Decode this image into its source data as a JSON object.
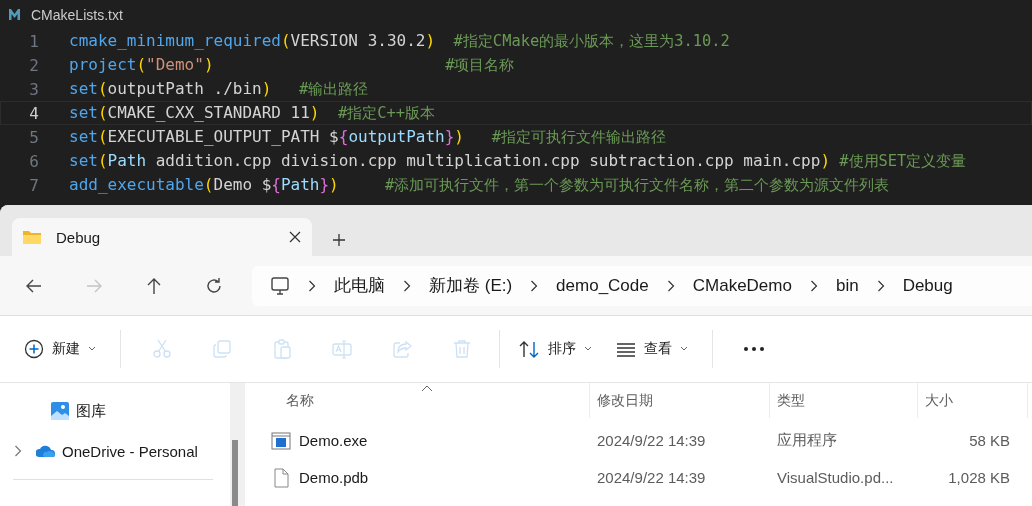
{
  "editor": {
    "file_tab": {
      "title": "CMakeLists.txt"
    },
    "lines": [
      {
        "number": "1",
        "current": false,
        "tokens": [
          {
            "kind": "func",
            "text": "cmake_minimum_required"
          },
          {
            "kind": "paren",
            "text": "("
          },
          {
            "kind": "plain",
            "text": "VERSION 3.30.2"
          },
          {
            "kind": "paren",
            "text": ")"
          },
          {
            "kind": "comment",
            "text": "  #指定CMake的最小版本，这里为3.10.2"
          }
        ]
      },
      {
        "number": "2",
        "current": false,
        "tokens": [
          {
            "kind": "func",
            "text": "project"
          },
          {
            "kind": "paren",
            "text": "("
          },
          {
            "kind": "string",
            "text": "\"Demo\""
          },
          {
            "kind": "paren",
            "text": ")"
          },
          {
            "kind": "comment",
            "text": "                         #项目名称"
          }
        ]
      },
      {
        "number": "3",
        "current": false,
        "tokens": [
          {
            "kind": "func",
            "text": "set"
          },
          {
            "kind": "paren",
            "text": "("
          },
          {
            "kind": "plain",
            "text": "outputPath ./bin"
          },
          {
            "kind": "paren",
            "text": ")"
          },
          {
            "kind": "comment",
            "text": "   #输出路径"
          }
        ]
      },
      {
        "number": "4",
        "current": true,
        "tokens": [
          {
            "kind": "func",
            "text": "set"
          },
          {
            "kind": "paren",
            "text": "("
          },
          {
            "kind": "plain",
            "text": "CMAKE_CXX_STANDARD 11"
          },
          {
            "kind": "paren",
            "text": ")"
          },
          {
            "kind": "comment",
            "text": "  #指定C++版本"
          }
        ]
      },
      {
        "number": "5",
        "current": false,
        "tokens": [
          {
            "kind": "func",
            "text": "set"
          },
          {
            "kind": "paren",
            "text": "("
          },
          {
            "kind": "plain",
            "text": "EXECUTABLE_OUTPUT_PATH $"
          },
          {
            "kind": "brace",
            "text": "{"
          },
          {
            "kind": "var",
            "text": "outputPath"
          },
          {
            "kind": "brace",
            "text": "}"
          },
          {
            "kind": "paren",
            "text": ")"
          },
          {
            "kind": "comment",
            "text": "   #指定可执行文件输出路径"
          }
        ]
      },
      {
        "number": "6",
        "current": false,
        "tokens": [
          {
            "kind": "func",
            "text": "set"
          },
          {
            "kind": "paren",
            "text": "("
          },
          {
            "kind": "var",
            "text": "Path"
          },
          {
            "kind": "plain",
            "text": " addition.cpp division.cpp multiplication.cpp subtraction.cpp main.cpp"
          },
          {
            "kind": "paren",
            "text": ")"
          },
          {
            "kind": "comment",
            "text": " #使用SET定义变量"
          }
        ]
      },
      {
        "number": "7",
        "current": false,
        "tokens": [
          {
            "kind": "func",
            "text": "add_executable"
          },
          {
            "kind": "paren",
            "text": "("
          },
          {
            "kind": "plain",
            "text": "Demo $"
          },
          {
            "kind": "brace",
            "text": "{"
          },
          {
            "kind": "var",
            "text": "Path"
          },
          {
            "kind": "brace",
            "text": "}"
          },
          {
            "kind": "paren",
            "text": ")"
          },
          {
            "kind": "comment",
            "text": "     #添加可执行文件，第一个参数为可执行文件名称，第二个参数为源文件列表"
          }
        ]
      }
    ]
  },
  "explorer": {
    "tabs": [
      {
        "title": "Debug",
        "selected": true
      }
    ],
    "nav": [
      {
        "kind": "back",
        "disabled": false
      },
      {
        "kind": "forward",
        "disabled": true
      },
      {
        "kind": "up",
        "disabled": false
      },
      {
        "kind": "refresh",
        "disabled": false
      }
    ],
    "breadcrumb": [
      "此电脑",
      "新加卷 (E:)",
      "demo_Code",
      "CMakeDemo",
      "bin",
      "Debug"
    ],
    "toolbar": [
      {
        "kind": "new",
        "label": "新建",
        "disabled": false
      },
      {
        "kind": "separator"
      },
      {
        "kind": "cut",
        "disabled": true
      },
      {
        "kind": "copy",
        "disabled": true
      },
      {
        "kind": "paste",
        "disabled": true
      },
      {
        "kind": "rename",
        "disabled": true
      },
      {
        "kind": "share",
        "disabled": true
      },
      {
        "kind": "delete",
        "disabled": true
      },
      {
        "kind": "separator"
      },
      {
        "kind": "sort",
        "label": "排序",
        "disabled": false
      },
      {
        "kind": "view",
        "label": "查看",
        "disabled": false
      },
      {
        "kind": "separator"
      },
      {
        "kind": "more",
        "disabled": false
      }
    ],
    "sidebar": [
      {
        "kind": "gallery",
        "label": "图库",
        "has_children": false
      },
      {
        "kind": "cloud",
        "label": "OneDrive - Personal",
        "has_children": true
      }
    ],
    "columns": [
      {
        "label": "名称",
        "sorted": true
      },
      {
        "label": "修改日期",
        "sorted": false
      },
      {
        "label": "类型",
        "sorted": false
      },
      {
        "label": "大小",
        "sorted": false
      }
    ],
    "rows": [
      {
        "kind": "exe",
        "name": "Demo.exe",
        "modified": "2024/9/22 14:39",
        "type": "应用程序",
        "size": "58 KB"
      },
      {
        "kind": "file",
        "name": "Demo.pdb",
        "modified": "2024/9/22 14:39",
        "type": "VisualStudio.pd...",
        "size": "1,028 KB"
      }
    ]
  }
}
